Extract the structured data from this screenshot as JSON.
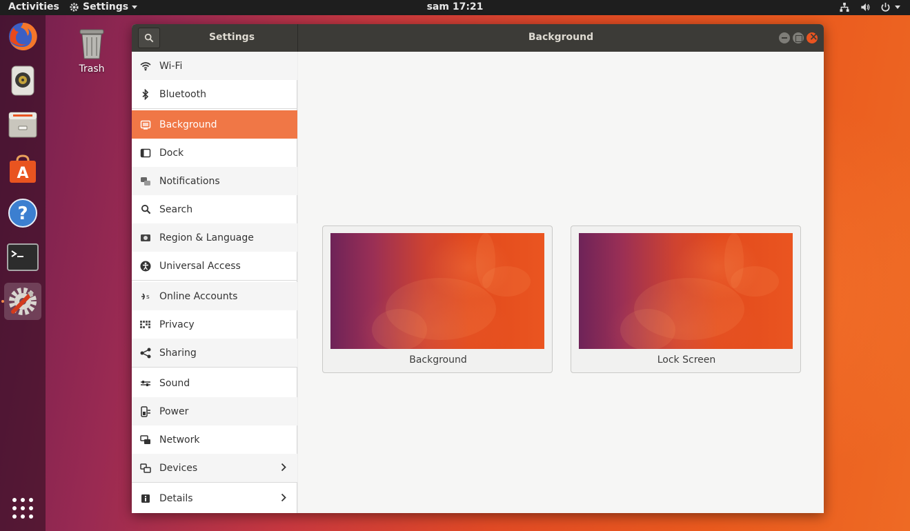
{
  "topbar": {
    "activities": "Activities",
    "app_menu": "Settings",
    "clock": "sam 17:21"
  },
  "desktop": {
    "trash_label": "Trash"
  },
  "dock": {
    "items": [
      {
        "name": "firefox-icon"
      },
      {
        "name": "rhythmbox-icon"
      },
      {
        "name": "files-icon"
      },
      {
        "name": "software-icon"
      },
      {
        "name": "help-icon"
      },
      {
        "name": "terminal-icon"
      },
      {
        "name": "settings-icon",
        "active": true
      },
      {
        "name": "app-grid-icon"
      }
    ]
  },
  "window": {
    "sidebar_title": "Settings",
    "title": "Background"
  },
  "sidebar": {
    "items": [
      {
        "label": "Wi-Fi",
        "icon": "wifi-icon"
      },
      {
        "label": "Bluetooth",
        "icon": "bluetooth-icon"
      },
      {
        "label": "Background",
        "icon": "background-icon",
        "selected": true
      },
      {
        "label": "Dock",
        "icon": "dock-icon"
      },
      {
        "label": "Notifications",
        "icon": "notifications-icon"
      },
      {
        "label": "Search",
        "icon": "search-icon"
      },
      {
        "label": "Region & Language",
        "icon": "region-icon"
      },
      {
        "label": "Universal Access",
        "icon": "universal-access-icon"
      },
      {
        "label": "Online Accounts",
        "icon": "online-accounts-icon"
      },
      {
        "label": "Privacy",
        "icon": "privacy-icon"
      },
      {
        "label": "Sharing",
        "icon": "sharing-icon"
      },
      {
        "label": "Sound",
        "icon": "sound-icon"
      },
      {
        "label": "Power",
        "icon": "power-icon"
      },
      {
        "label": "Network",
        "icon": "network-icon"
      },
      {
        "label": "Devices",
        "icon": "devices-icon",
        "has_submenu": true
      },
      {
        "label": "Details",
        "icon": "details-icon",
        "has_submenu": true
      }
    ]
  },
  "main": {
    "cards": [
      {
        "label": "Background"
      },
      {
        "label": "Lock Screen"
      }
    ]
  },
  "colors": {
    "accent": "#f07746",
    "titlebar": "#3c3b37",
    "close_button": "#e95420"
  }
}
